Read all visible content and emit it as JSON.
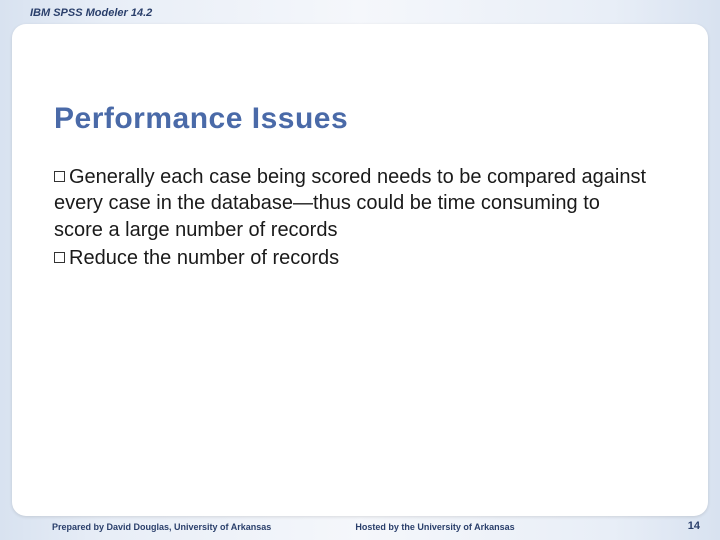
{
  "header": {
    "label": "IBM SPSS Modeler 14.2"
  },
  "title": "Performance Issues",
  "bullets": [
    "Generally each case being scored needs to be compared against every case in the database—thus could be time consuming to score a large number of records",
    "Reduce the number of records"
  ],
  "footer": {
    "left": "Prepared by David Douglas, University of Arkansas",
    "center": "Hosted by the University of Arkansas",
    "page": "14"
  }
}
